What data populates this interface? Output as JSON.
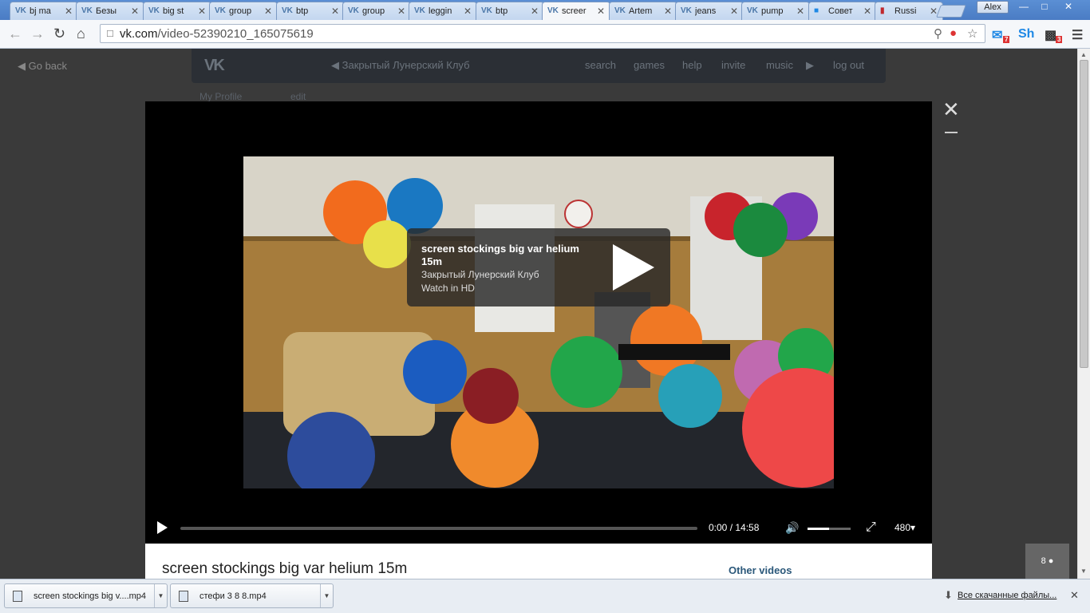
{
  "browser": {
    "tabs": [
      {
        "label": "bj ma",
        "icon": "vk"
      },
      {
        "label": "Безы",
        "icon": "vk"
      },
      {
        "label": "big st",
        "icon": "vk"
      },
      {
        "label": "group",
        "icon": "vk"
      },
      {
        "label": "btp",
        "icon": "vk"
      },
      {
        "label": "group",
        "icon": "vk"
      },
      {
        "label": "leggin",
        "icon": "vk"
      },
      {
        "label": "btp",
        "icon": "vk"
      },
      {
        "label": "screer",
        "icon": "vk",
        "active": true
      },
      {
        "label": "Artem",
        "icon": "vk"
      },
      {
        "label": "jeans",
        "icon": "vk"
      },
      {
        "label": "pump",
        "icon": "vk"
      },
      {
        "label": "Совет",
        "icon": "cube"
      },
      {
        "label": "Russi",
        "icon": "book"
      }
    ],
    "user": "Alex",
    "url_host": "vk.com",
    "url_path": "/video-52390210_165075619",
    "extensions": {
      "badge1": "7",
      "sh": "Sh",
      "badge2": "3"
    }
  },
  "vk": {
    "go_back": "Go back",
    "group_name": "Закрытый Лунерский Клуб",
    "menu": [
      "search",
      "games",
      "help",
      "invite",
      "music"
    ],
    "log_out": "log out",
    "left_link": "My Profile",
    "edit": "edit"
  },
  "video": {
    "title": "screen stockings big var helium 15m",
    "group": "Закрытый Лунерский Клуб",
    "watch_hd": "Watch in HD",
    "time": "0:00 / 14:58",
    "quality": "480",
    "volume_level": 0.5,
    "progress": 0,
    "other_videos": "Other videos",
    "counter": "8"
  },
  "downloads": {
    "items": [
      {
        "name": "screen stockings big v....mp4"
      },
      {
        "name": "стефи 3 8 8.mp4"
      }
    ],
    "all_files": "Все скачанные файлы..."
  },
  "colors": {
    "vk_link": "#2b587a",
    "tabstrip": "#4a7cc4",
    "player_bg": "#000000"
  }
}
